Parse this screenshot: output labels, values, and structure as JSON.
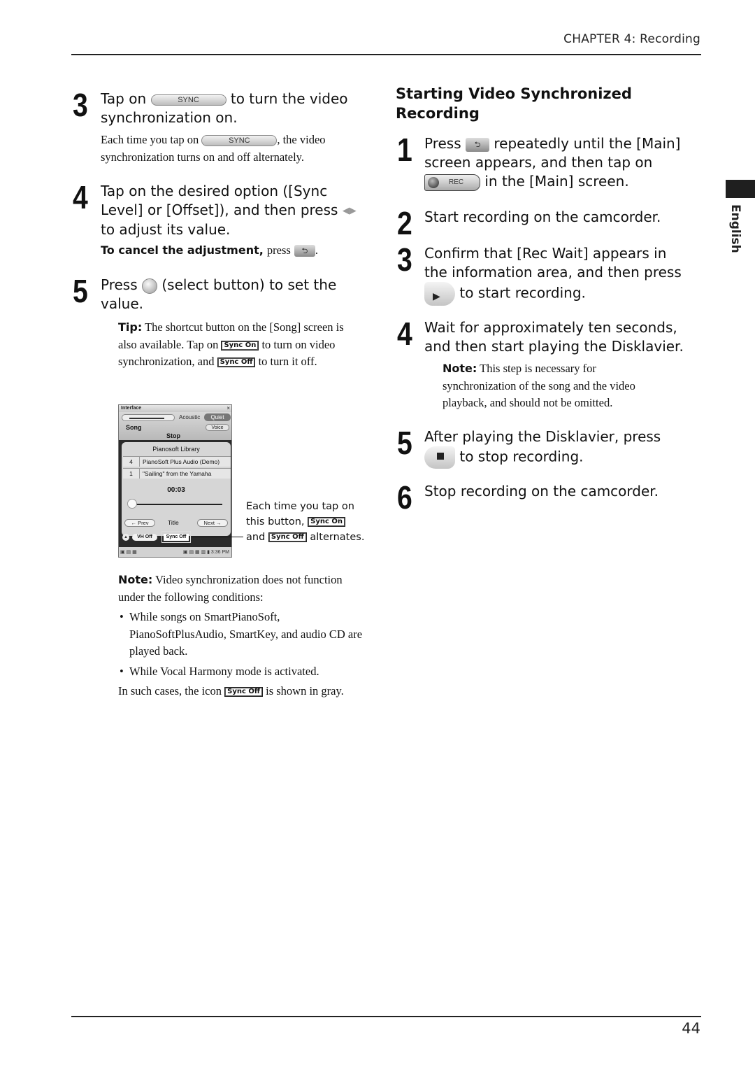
{
  "header": {
    "chapter": "CHAPTER 4: Recording"
  },
  "side_tab": {
    "label": "English"
  },
  "footer": {
    "page_number": "44"
  },
  "left_column": {
    "step3": {
      "number": "3",
      "text_before": "Tap on",
      "button_label": "SYNC",
      "text_after": "to turn the video synchronization on.",
      "body_before": "Each time you tap on",
      "body_button": "SYNC",
      "body_after": ", the video synchronization turns on and off alternately."
    },
    "step4": {
      "number": "4",
      "text": "Tap on the desired option ([Sync Level] or [Offset]), and then press",
      "arrows_icon": "left-right-arrows-icon",
      "text_after": "to adjust its value.",
      "cancel_label": "To cancel the adjustment,",
      "cancel_text": "press",
      "back_icon": "⮌"
    },
    "step5": {
      "number": "5",
      "text_before": "Press",
      "text_after": "(select button) to set the value.",
      "tip_label": "Tip:",
      "tip_text1": "The shortcut button on the [Song] screen is also available. Tap on",
      "sync_on": "Sync On",
      "tip_text2": "to turn on video synchronization, and",
      "sync_off": "Sync Off",
      "tip_text3": "to turn it off."
    },
    "device_screen": {
      "title": "Interface",
      "close": "×",
      "acoustic": "Acoustic",
      "quiet": "Quiet",
      "song": "Song",
      "voice": "Voice",
      "stop": "Stop",
      "library": "Pianosoft Library",
      "rows": [
        {
          "num": "4",
          "title": "PianoSoft Plus Audio (Demo)"
        },
        {
          "num": "1",
          "title": "\"Sailing\"    from the Yamaha"
        }
      ],
      "time": "00:03",
      "prev": "← Prev",
      "title_label": "Title",
      "next": "Next →",
      "up": "▲",
      "vh_off": "VH Off",
      "sync_off": "Sync Off",
      "taskbar_left": "▣ ▤ ▦",
      "taskbar_right": "▣ ▤ ▦ ▥ ▮ 3:36 PM"
    },
    "callout": {
      "text1": "Each time you tap on this button,",
      "sync_on": "Sync On",
      "text2": "and",
      "sync_off": "Sync Off",
      "text3": "alternates."
    },
    "note": {
      "label": "Note:",
      "text": "Video synchronization does not function under the following conditions:",
      "bullets": [
        "While songs on SmartPianoSoft, PianoSoftPlusAudio, SmartKey, and audio CD are played back.",
        "While Vocal Harmony mode is activated."
      ],
      "closing_before": "In such cases, the icon",
      "closing_icon": "Sync Off",
      "closing_after": "is shown in gray."
    }
  },
  "right_column": {
    "section_title": "Starting Video Synchronized Recording",
    "steps": [
      {
        "number": "1",
        "text_before": "Press",
        "back_icon": "⮌",
        "text_mid": "repeatedly until the [Main] screen appears, and then tap on",
        "rec_label": "REC",
        "text_after": "in the [Main] screen."
      },
      {
        "number": "2",
        "text": "Start recording on the camcorder."
      },
      {
        "number": "3",
        "text": "Confirm that [Rec Wait] appears in the information area, and then press",
        "play_icon": "▶",
        "text_after": "to start recording."
      },
      {
        "number": "4",
        "text": "Wait for approximately ten seconds, and then start playing the Disklavier.",
        "note_label": "Note:",
        "note_text": "This step is necessary for synchronization of the song and the video playback, and should not be omitted."
      },
      {
        "number": "5",
        "text": "After playing the Disklavier, press",
        "text_after": "to stop recording."
      },
      {
        "number": "6",
        "text": "Stop recording on the camcorder."
      }
    ]
  }
}
